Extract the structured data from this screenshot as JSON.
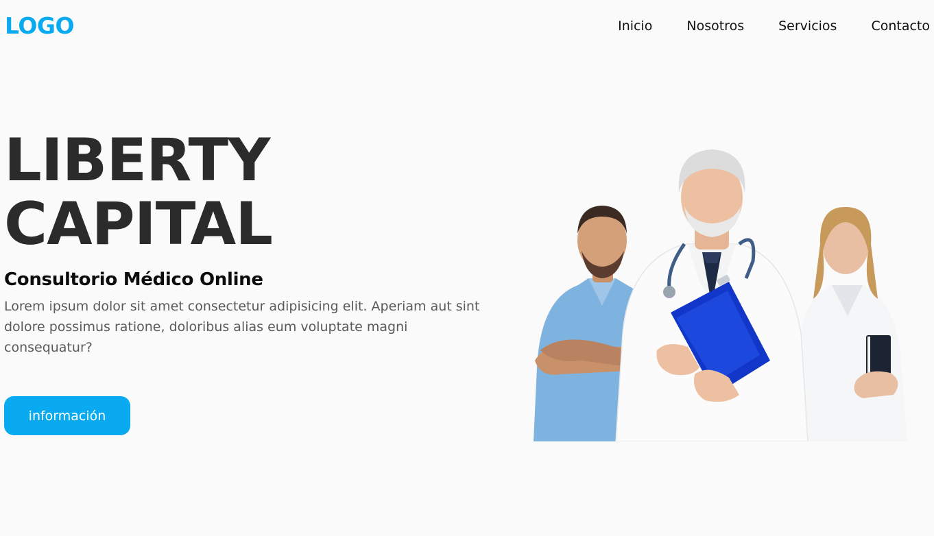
{
  "header": {
    "logo": "LOGO",
    "nav": [
      {
        "label": "Inicio"
      },
      {
        "label": "Nosotros"
      },
      {
        "label": "Servicios"
      },
      {
        "label": "Contacto"
      }
    ]
  },
  "hero": {
    "title_line1": "LIBERTY",
    "title_line2": "CAPITAL",
    "subtitle": "Consultorio Médico Online",
    "description": "Lorem ipsum dolor sit amet consectetur adipisicing elit. Aperiam aut sint dolore possimus ratione, doloribus alias eum voluptate magni consequatur?",
    "cta_label": "información",
    "image": "doctors-team-photo"
  },
  "colors": {
    "accent": "#0aaaf0",
    "background": "#fafafa",
    "title": "#2b2b2b",
    "text": "#5a5a5a"
  }
}
